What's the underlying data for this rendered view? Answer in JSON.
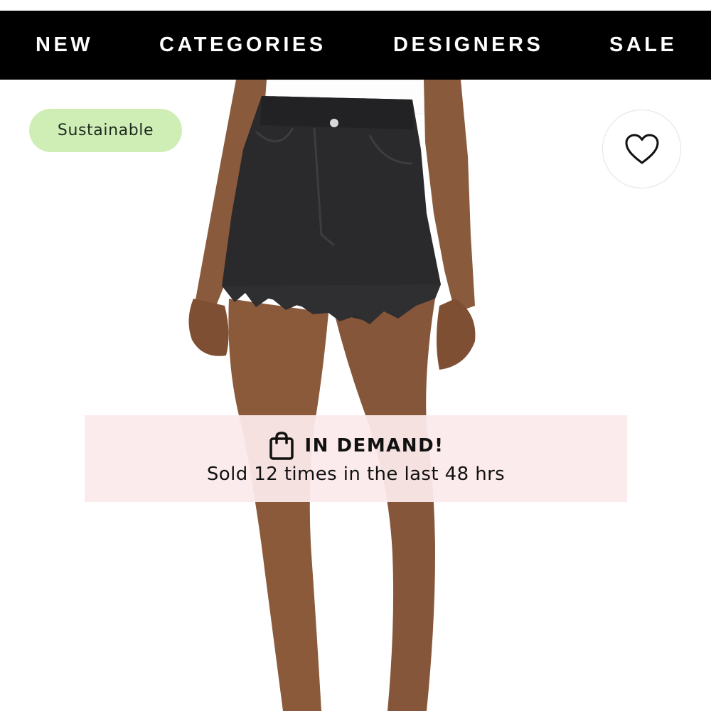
{
  "nav": {
    "items": [
      {
        "label": "NEW"
      },
      {
        "label": "CATEGORIES"
      },
      {
        "label": "DESIGNERS"
      },
      {
        "label": "SALE"
      }
    ],
    "background": "#000000",
    "text_color": "#ffffff"
  },
  "badge": {
    "label": "Sustainable",
    "color": "#cfeeb6"
  },
  "wishlist": {
    "icon": "heart-outline-icon"
  },
  "demand": {
    "icon": "shopping-bag-icon",
    "title": "IN DEMAND!",
    "subtitle": "Sold 12 times in the last 48 hrs",
    "background": "#fceaeb"
  },
  "product": {
    "image": "model wearing black high-rise cut-off denim shorts and white top"
  }
}
